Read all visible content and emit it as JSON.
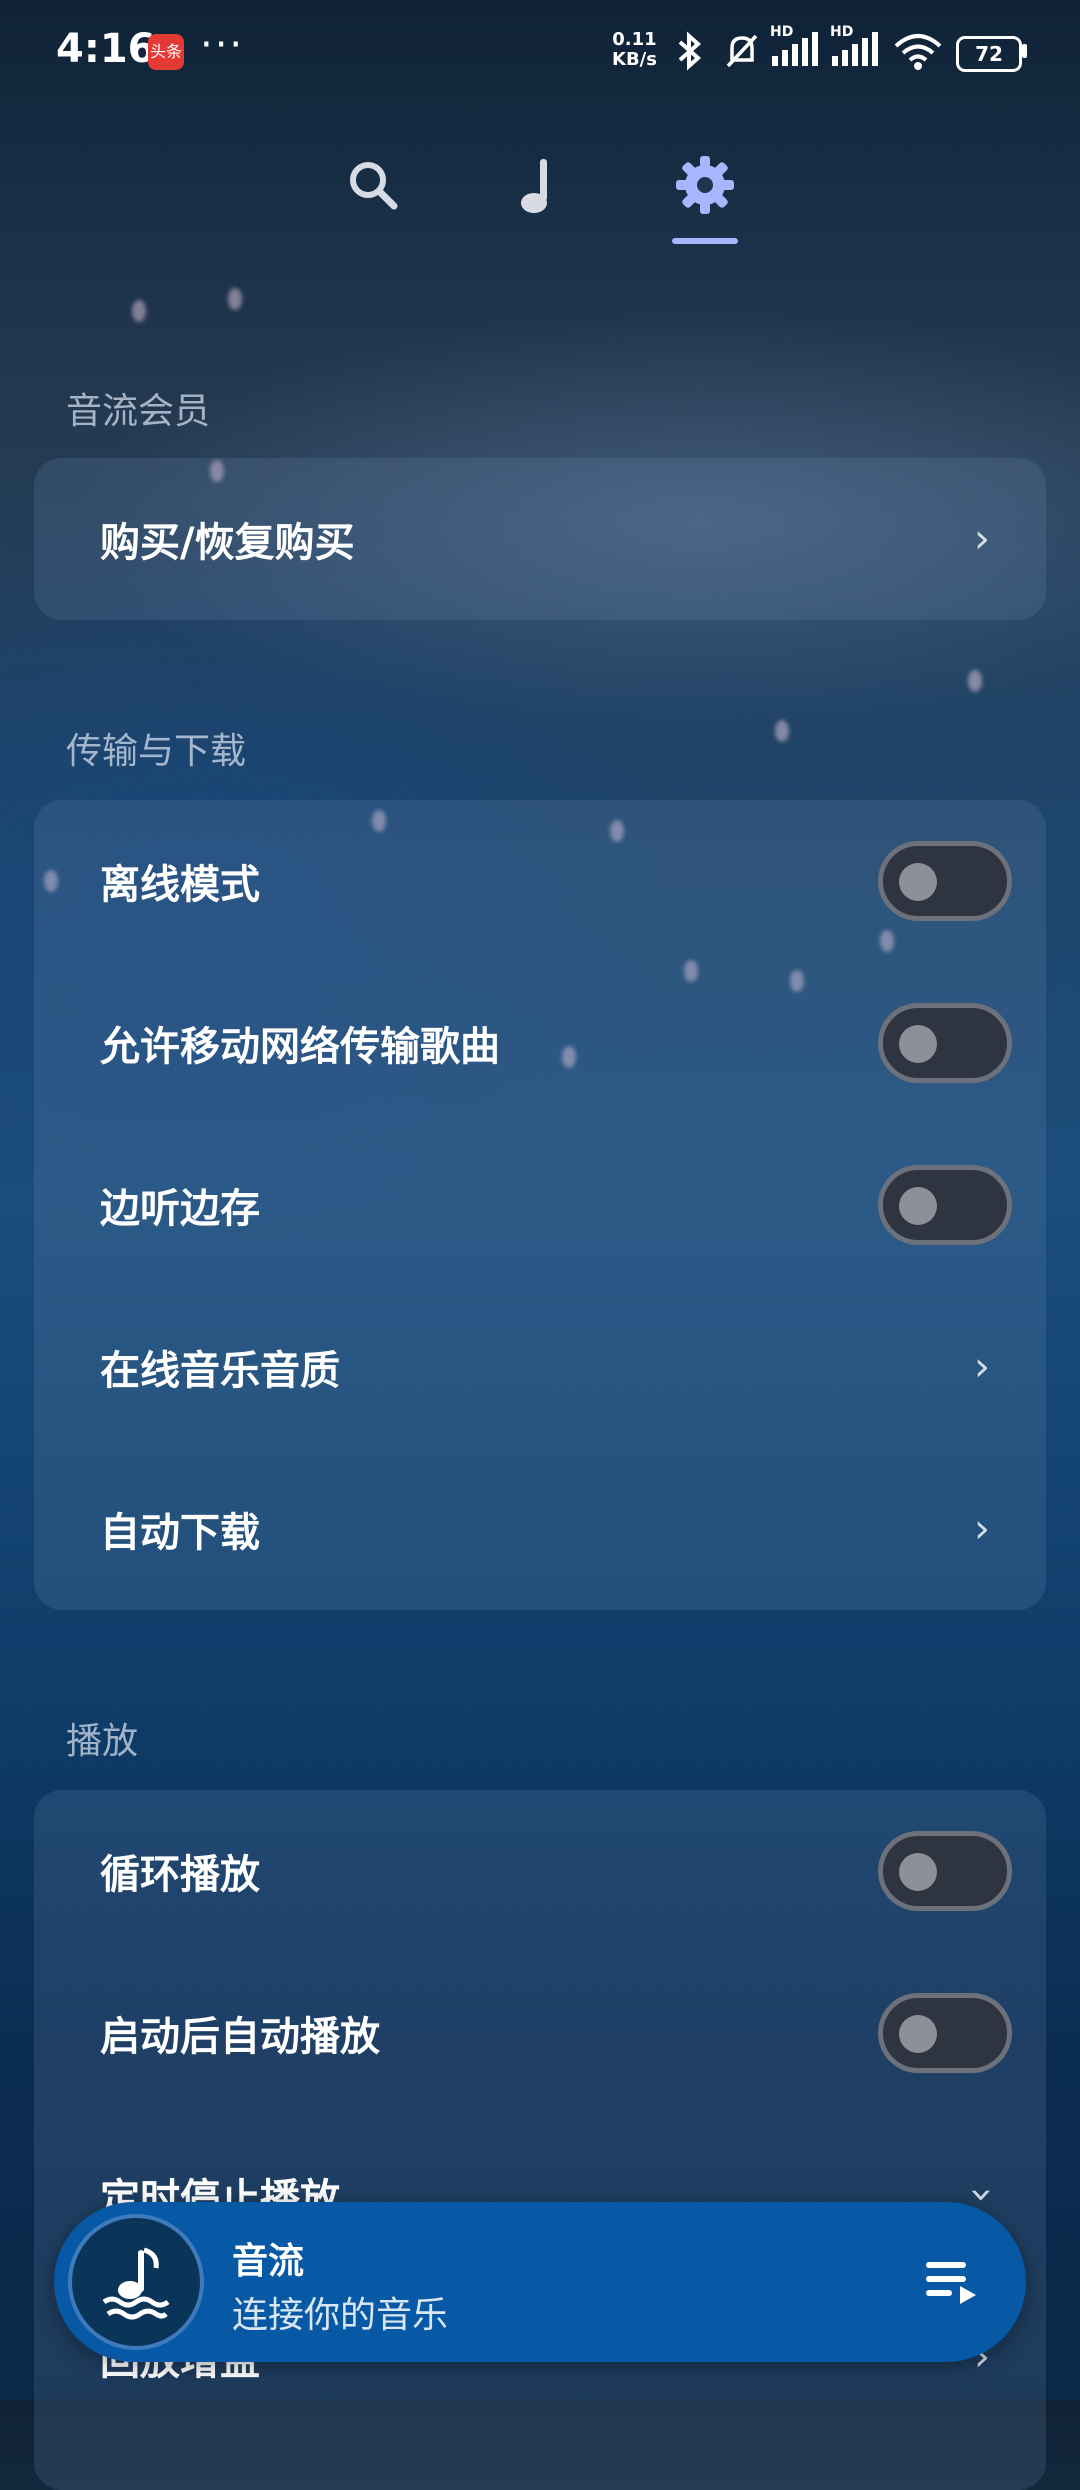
{
  "status_bar": {
    "time": "4:16",
    "news_badge": "头条",
    "more": "···",
    "net_speed_value": "0.11",
    "net_speed_unit": "KB/s",
    "hd1": "HD",
    "hd2": "HD",
    "battery": "72",
    "icons": [
      "bluetooth-icon",
      "mute-icon",
      "signal-icon",
      "signal-icon",
      "wifi-icon",
      "battery-icon"
    ]
  },
  "nav": {
    "tabs": [
      "search-icon",
      "music-note-icon",
      "settings-gear-icon"
    ],
    "active_tab": "settings",
    "accent": "#a9b6ff"
  },
  "sections": [
    {
      "title": "音流会员",
      "items": [
        {
          "label": "购买/恢复购买",
          "control": "chevron"
        }
      ]
    },
    {
      "title": "传输与下载",
      "items": [
        {
          "label": "离线模式",
          "control": "toggle",
          "on": false
        },
        {
          "label": "允许移动网络传输歌曲",
          "control": "toggle",
          "on": false
        },
        {
          "label": "边听边存",
          "control": "toggle",
          "on": false
        },
        {
          "label": "在线音乐音质",
          "control": "chevron"
        },
        {
          "label": "自动下载",
          "control": "chevron"
        }
      ]
    },
    {
      "title": "播放",
      "items": [
        {
          "label": "循环播放",
          "control": "toggle",
          "on": false
        },
        {
          "label": "启动后自动播放",
          "control": "toggle",
          "on": false
        },
        {
          "label": "定时停止播放",
          "control": "chevron-down"
        },
        {
          "label": "回放增益",
          "control": "chevron"
        }
      ]
    }
  ],
  "player": {
    "title": "音流",
    "subtitle": "连接你的音乐",
    "color": "#0759a6"
  }
}
